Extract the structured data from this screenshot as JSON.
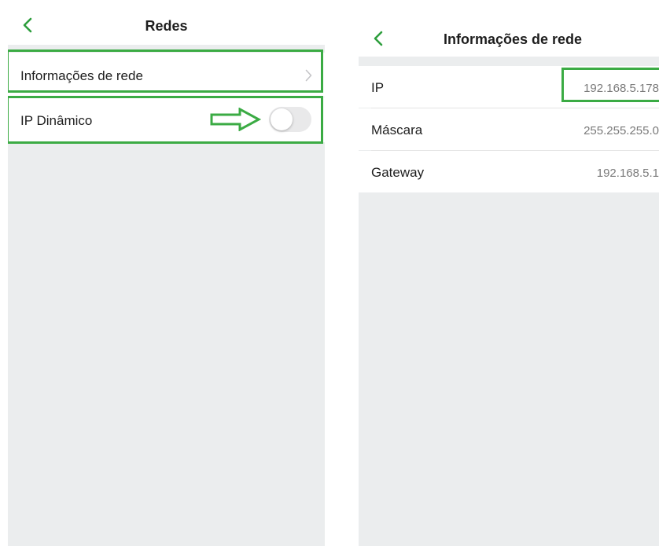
{
  "left_screen": {
    "title": "Redes",
    "rows": [
      {
        "label": "Informações de rede"
      },
      {
        "label": "IP Dinâmico",
        "toggle_on": false
      }
    ]
  },
  "right_screen": {
    "title": "Informações de rede",
    "rows": [
      {
        "label": "IP",
        "value": "192.168.5.178"
      },
      {
        "label": "Máscara",
        "value": "255.255.255.0"
      },
      {
        "label": "Gateway",
        "value": "192.168.5.1"
      }
    ]
  },
  "colors": {
    "accent_green": "#3bab44",
    "background_gray": "#ebedee",
    "toggle_off": "#e9e9ea"
  },
  "icons": [
    "chevron-left-icon",
    "chevron-right-icon",
    "arrow-right-outline-icon"
  ]
}
